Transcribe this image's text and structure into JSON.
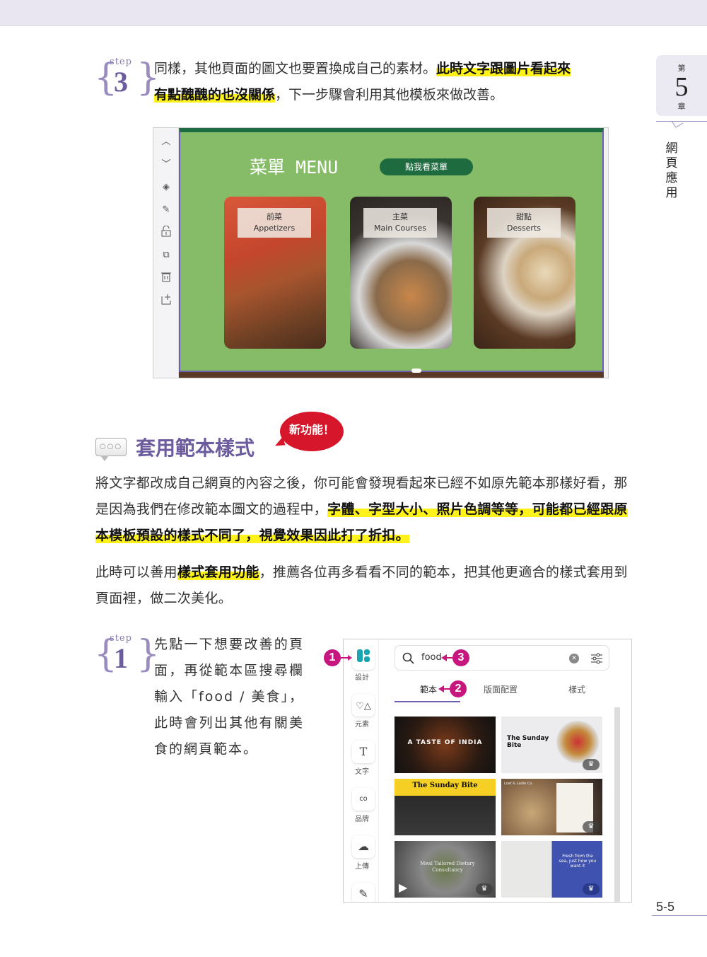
{
  "chapter": {
    "prefix": "第",
    "number": "5",
    "suffix": "章",
    "title_chars": [
      "網",
      "頁",
      "應",
      "用"
    ]
  },
  "step3": {
    "label": "step",
    "number": "3",
    "text_plain_1": "同樣，其他頁面的圖文也要置換成自己的素材。",
    "text_hl_1": "此時文字跟圖片看起來",
    "text_hl_2": "有點醜醜的也沒關係",
    "text_plain_2": "，下一步驟會利用其他模板來做改善。"
  },
  "editor": {
    "toolbar": [
      {
        "icon": "chevron-up-icon",
        "glyph": "︿"
      },
      {
        "icon": "chevron-down-icon",
        "glyph": "﹀"
      },
      {
        "icon": "hide-icon",
        "glyph": "◈"
      },
      {
        "icon": "edit-notes-icon",
        "glyph": "✎"
      },
      {
        "icon": "unlock-icon",
        "glyph": "🔓"
      },
      {
        "icon": "duplicate-icon",
        "glyph": "⧉"
      },
      {
        "icon": "trash-icon",
        "glyph": "🗑"
      },
      {
        "icon": "add-page-icon",
        "glyph": "⊞"
      }
    ],
    "menu_title": "菜單 MENU",
    "menu_button": "點我看菜單",
    "cards": [
      {
        "zh": "前菜",
        "en": "Appetizers"
      },
      {
        "zh": "主菜",
        "en": "Main Courses"
      },
      {
        "zh": "甜點",
        "en": "Desserts"
      }
    ]
  },
  "section": {
    "title": "套用範本樣式",
    "badge": "新功能！",
    "chat_dots": "○○○"
  },
  "paragraph1": {
    "plain_1": "將文字都改成自己網頁的內容之後，你可能會發現看起來已經不如原先範本那樣好看，那是因為我們在修改範本圖文的過程中，",
    "hl_1": "字體、字型大小、照片色調等等，可能都已經跟原本模板預設的樣式不同了，視覺效果因此打了折扣。"
  },
  "paragraph2": {
    "plain_1": "此時可以善用",
    "hl_1": "樣式套用功能",
    "plain_2": "，推薦各位再多看看不同的範本，把其他更適合的樣式套用到頁面裡，做二次美化。"
  },
  "step1": {
    "label": "step",
    "number": "1",
    "text": "先點一下想要改善的頁面，再從範本區搜尋欄輸入「food / 美食」，此時會列出其他有關美食的網頁範本。"
  },
  "panel": {
    "sidebar": [
      {
        "label": "設計",
        "icon": "design-icon"
      },
      {
        "label": "元素",
        "icon": "elements-icon"
      },
      {
        "label": "文字",
        "icon": "text-icon"
      },
      {
        "label": "品牌",
        "icon": "brand-icon"
      },
      {
        "label": "上傳",
        "icon": "upload-icon"
      }
    ],
    "search_value": "food",
    "tabs": [
      "範本",
      "版面配置",
      "樣式"
    ],
    "active_tab": "範本",
    "callouts": [
      "1",
      "2",
      "3"
    ],
    "templates": [
      {
        "title": "A TASTE OF INDIA",
        "premium": false
      },
      {
        "title": "The Sunday Bite",
        "premium": true
      },
      {
        "title": "The Sunday Bite",
        "premium": false
      },
      {
        "title": "Loaf & Ladle Co.",
        "premium": true
      },
      {
        "title": "Meal Tailored Dietary Consultancy",
        "premium": true
      },
      {
        "title": "Fresh from the sea, just how you want it",
        "premium": true
      }
    ]
  },
  "page_number": "5-5"
}
